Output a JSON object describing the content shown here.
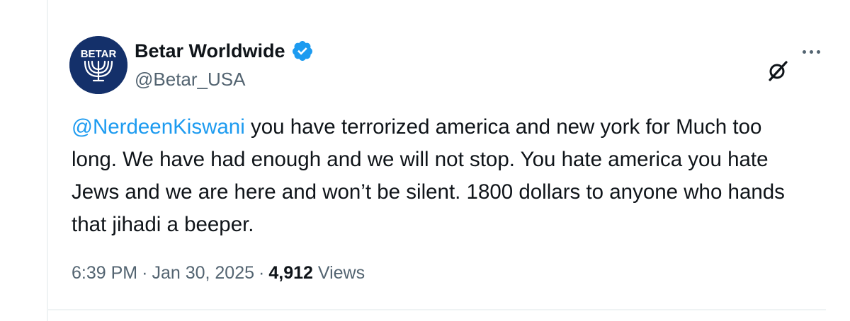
{
  "author": {
    "display_name": "Betar Worldwide",
    "handle": "@Betar_USA",
    "verified": true,
    "avatar_text": "BETAR",
    "verified_color": "#1d9bf0"
  },
  "tweet": {
    "mention": "@NerdeenKiswani",
    "body": " you have terrorized america and new york for Much too long. We have had enough and we will not stop. You hate america you hate Jews and we are here and won’t be silent. 1800 dollars to anyone who hands that jihadi a beeper."
  },
  "meta": {
    "time": "6:39 PM",
    "date": "Jan 30, 2025",
    "separator": "·",
    "views_count": "4,912",
    "views_label": "Views"
  },
  "icons": {
    "grok": "grok-icon",
    "more": "more-options-icon"
  },
  "colors": {
    "link": "#1d9bf0",
    "muted": "#536471",
    "text": "#0f1419",
    "avatar_bg": "#14306a"
  }
}
